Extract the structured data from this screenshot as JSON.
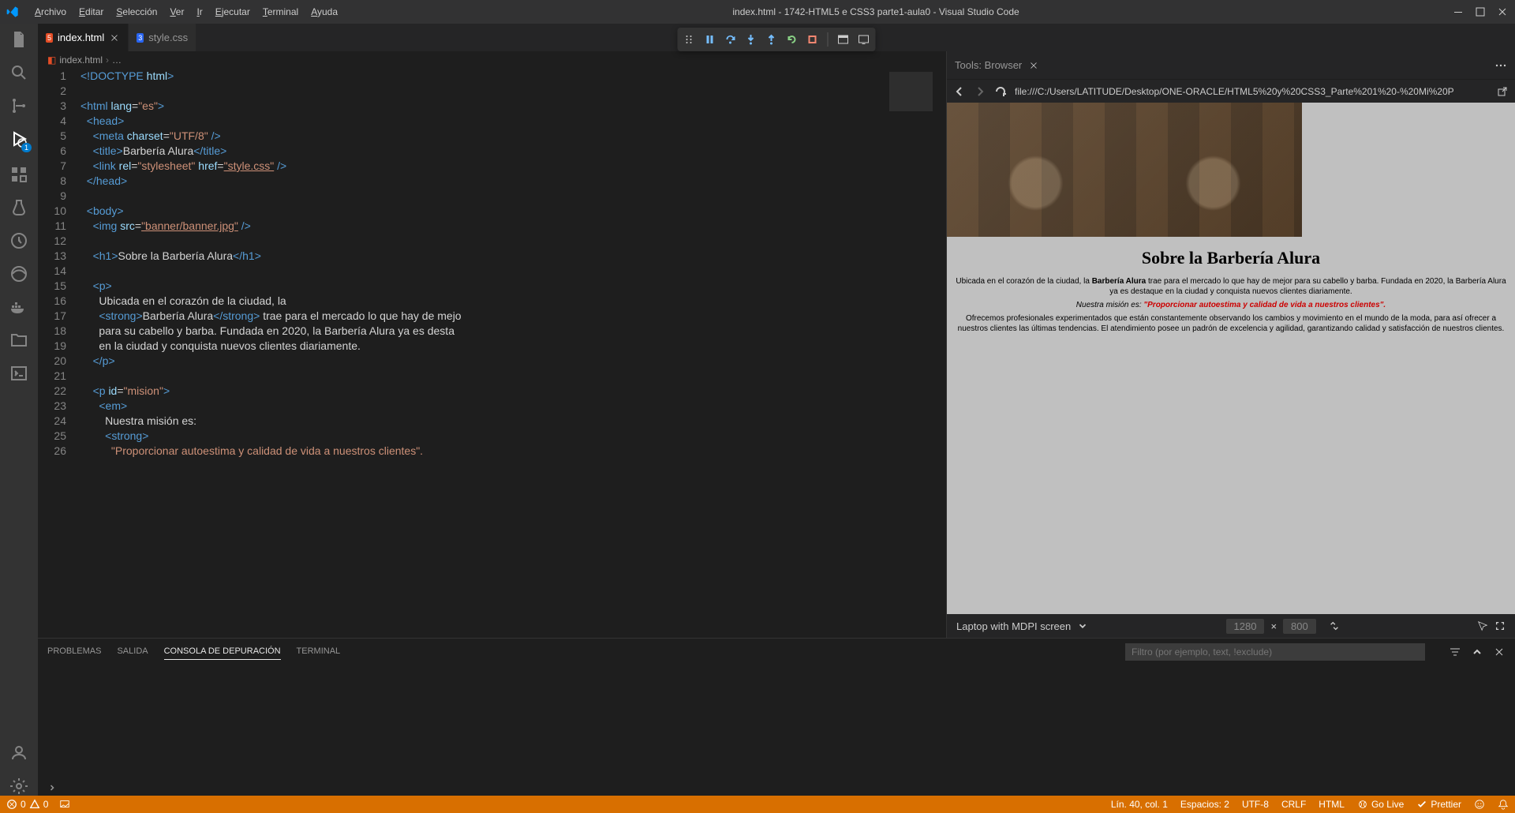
{
  "menubar": {
    "items": [
      "Archivo",
      "Editar",
      "Selección",
      "Ver",
      "Ir",
      "Ejecutar",
      "Terminal",
      "Ayuda"
    ],
    "title": "index.html - 1742-HTML5 e CSS3 parte1-aula0 - Visual Studio Code"
  },
  "tabs": {
    "items": [
      {
        "label": "index.html",
        "active": true,
        "icon": "html"
      },
      {
        "label": "style.css",
        "active": false,
        "icon": "css"
      }
    ]
  },
  "breadcrumb": {
    "file": "index.html",
    "more": "…"
  },
  "browser_tool": {
    "title": "Tools: Browser"
  },
  "preview": {
    "url": "file:///C:/Users/LATITUDE/Desktop/ONE-ORACLE/HTML5%20y%20CSS3_Parte%201%20-%20Mi%20P",
    "h1": "Sobre la Barbería Alura",
    "p1_a": "Ubicada en el corazón de la ciudad, la ",
    "p1_strong": "Barbería Alura",
    "p1_b": " trae para el mercado lo que hay de mejor para su cabello y barba. Fundada en 2020, la Barbería Alura ya es destaque en la ciudad y conquista nuevos clientes diariamente.",
    "p2_a": "Nuestra misión es: ",
    "p2_strong": "\"Proporcionar autoestima y calidad de vida a nuestros clientes\".",
    "p3": "Ofrecemos profesionales experimentados que están constantemente observando los cambios y movimiento en el mundo de la moda, para así ofrecer a nuestros clientes las últimas tendencias. El atendimiento posee un padrón de excelencia y agilidad, garantizando calidad y satisfacción de nuestros clientes.",
    "device": "Laptop with MDPI screen",
    "width": "1280",
    "height": "800"
  },
  "code": {
    "lines": [
      {
        "n": 1,
        "html": "<span class='tag-b'>&lt;!</span><span class='doctype'>DOCTYPE</span> <span class='attr-n'>html</span><span class='tag-b'>&gt;</span>"
      },
      {
        "n": 2,
        "html": ""
      },
      {
        "n": 3,
        "html": "<span class='tag-b'>&lt;</span><span class='tag-n'>html</span> <span class='attr-n'>lang</span>=<span class='attr-v'>\"es\"</span><span class='tag-b'>&gt;</span>"
      },
      {
        "n": 4,
        "html": "  <span class='tag-b'>&lt;</span><span class='tag-n'>head</span><span class='tag-b'>&gt;</span>"
      },
      {
        "n": 5,
        "html": "    <span class='tag-b'>&lt;</span><span class='tag-n'>meta</span> <span class='attr-n'>charset</span>=<span class='attr-v'>\"UTF/8\"</span> <span class='tag-b'>/&gt;</span>"
      },
      {
        "n": 6,
        "html": "    <span class='tag-b'>&lt;</span><span class='tag-n'>title</span><span class='tag-b'>&gt;</span><span class='txt'>Barbería Alura</span><span class='tag-b'>&lt;/</span><span class='tag-n'>title</span><span class='tag-b'>&gt;</span>"
      },
      {
        "n": 7,
        "html": "    <span class='tag-b'>&lt;</span><span class='tag-n'>link</span> <span class='attr-n'>rel</span>=<span class='attr-v'>\"stylesheet\"</span> <span class='attr-n'>href</span>=<span class='attr-v underline'>\"style.css\"</span> <span class='tag-b'>/&gt;</span>"
      },
      {
        "n": 8,
        "html": "  <span class='tag-b'>&lt;/</span><span class='tag-n'>head</span><span class='tag-b'>&gt;</span>"
      },
      {
        "n": 9,
        "html": ""
      },
      {
        "n": 10,
        "html": "  <span class='tag-b'>&lt;</span><span class='tag-n'>body</span><span class='tag-b'>&gt;</span>"
      },
      {
        "n": 11,
        "html": "    <span class='tag-b'>&lt;</span><span class='tag-n'>img</span> <span class='attr-n'>src</span>=<span class='attr-v underline'>\"banner/banner.jpg\"</span> <span class='tag-b'>/&gt;</span>"
      },
      {
        "n": 12,
        "html": ""
      },
      {
        "n": 13,
        "html": "    <span class='tag-b'>&lt;</span><span class='tag-n'>h1</span><span class='tag-b'>&gt;</span><span class='txt'>Sobre la Barbería Alura</span><span class='tag-b'>&lt;/</span><span class='tag-n'>h1</span><span class='tag-b'>&gt;</span>"
      },
      {
        "n": 14,
        "html": ""
      },
      {
        "n": 15,
        "html": "    <span class='tag-b'>&lt;</span><span class='tag-n'>p</span><span class='tag-b'>&gt;</span>"
      },
      {
        "n": 16,
        "html": "      <span class='txt'>Ubicada en el corazón de la ciudad, la</span>"
      },
      {
        "n": 17,
        "html": "      <span class='tag-b'>&lt;</span><span class='tag-n'>strong</span><span class='tag-b'>&gt;</span><span class='txt'>Barbería Alura</span><span class='tag-b'>&lt;/</span><span class='tag-n'>strong</span><span class='tag-b'>&gt;</span><span class='txt'> trae para el mercado lo que hay de mejo</span>"
      },
      {
        "n": 18,
        "html": "      <span class='txt'>para su cabello y barba. Fundada en 2020, la Barbería Alura ya es desta</span>"
      },
      {
        "n": 19,
        "html": "      <span class='txt'>en la ciudad y conquista nuevos clientes diariamente.</span>"
      },
      {
        "n": 20,
        "html": "    <span class='tag-b'>&lt;/</span><span class='tag-n'>p</span><span class='tag-b'>&gt;</span>"
      },
      {
        "n": 21,
        "html": ""
      },
      {
        "n": 22,
        "html": "    <span class='tag-b'>&lt;</span><span class='tag-n'>p</span> <span class='attr-n'>id</span>=<span class='attr-v'>\"mision\"</span><span class='tag-b'>&gt;</span>"
      },
      {
        "n": 23,
        "html": "      <span class='tag-b'>&lt;</span><span class='tag-n'>em</span><span class='tag-b'>&gt;</span>"
      },
      {
        "n": 24,
        "html": "        <span class='txt'>Nuestra misión es:</span>"
      },
      {
        "n": 25,
        "html": "        <span class='tag-b'>&lt;</span><span class='tag-n'>strong</span><span class='tag-b'>&gt;</span>"
      },
      {
        "n": 26,
        "html": "          <span class='attr-v'>\"Proporcionar autoestima y calidad de vida a nuestros clientes\".</span>"
      }
    ]
  },
  "panel": {
    "tabs": [
      "PROBLEMAS",
      "SALIDA",
      "CONSOLA DE DEPURACIÓN",
      "TERMINAL"
    ],
    "active": 2,
    "filter_placeholder": "Filtro (por ejemplo, text, !exclude)"
  },
  "status": {
    "errors": "0",
    "warnings": "0",
    "ln_col": "Lín. 40, col. 1",
    "spaces": "Espacios: 2",
    "encoding": "UTF-8",
    "eol": "CRLF",
    "lang": "HTML",
    "golive": "Go Live",
    "prettier": "Prettier"
  },
  "activity_badge": "1"
}
